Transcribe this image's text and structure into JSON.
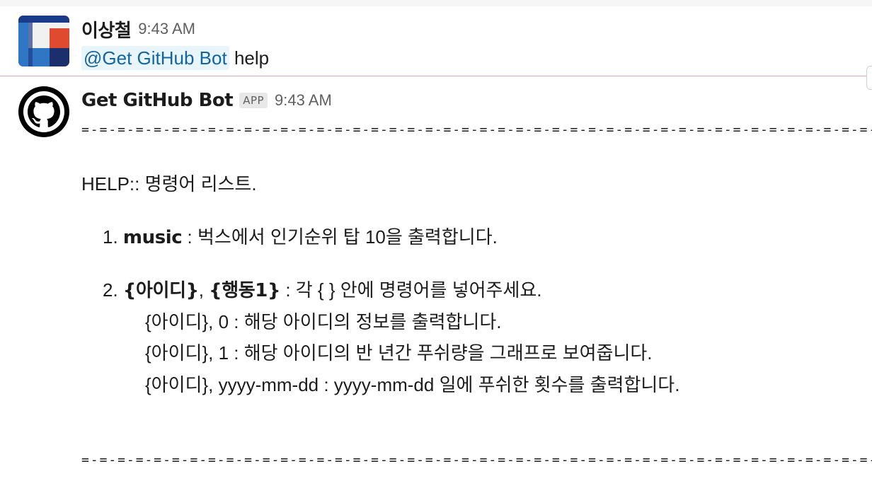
{
  "messages": [
    {
      "sender": "이상철",
      "timestamp": "9:43 AM",
      "avatar_icon": "workspace-avatar-icon",
      "mention": "@Get GitHub Bot",
      "text": "help"
    },
    {
      "sender": "Get GitHub Bot",
      "badge": "APP",
      "timestamp": "9:43 AM",
      "avatar_icon": "github-octocat-icon",
      "separator": "=-=-=-=-=-=-=-=-=-=-=-=-=-=-=-=-=-=-=-=-=-=-=-=-=-=-=-=-=-=-=-=-=-=-=-=-=-=-=-=-=-=-=-=-=-=-=-=-=-=-=",
      "help_title": "HELP:: 명령어 리스트.",
      "item1_prefix": "1. ",
      "item1_command": "music",
      "item1_desc": " : 벅스에서 인기순위 탑 10을 출력합니다.",
      "item2_prefix": "2. ",
      "item2_command_a": "{아이디}",
      "item2_comma": ", ",
      "item2_command_b": "{행동1}",
      "item2_desc": " : 각 { } 안에 명령어를 넣어주세요.",
      "sub_lines": [
        "{아이디}, 0 : 해당 아이디의 정보를 출력합니다.",
        "{아이디}, 1 : 해당 아이디의 반 년간 푸쉬량을 그래프로 보여줍니다.",
        "{아이디}, yyyy-mm-dd : yyyy-mm-dd 일에 푸쉬한 횟수를 출력합니다."
      ]
    }
  ],
  "colors": {
    "mention_bg": "#e8f5fa",
    "mention_text": "#1264a3",
    "new_message_divider": "#e7a6aa",
    "avatar_red": "#e04a2f",
    "avatar_blue": "#2f77c4",
    "avatar_navy": "#1f3c88"
  }
}
